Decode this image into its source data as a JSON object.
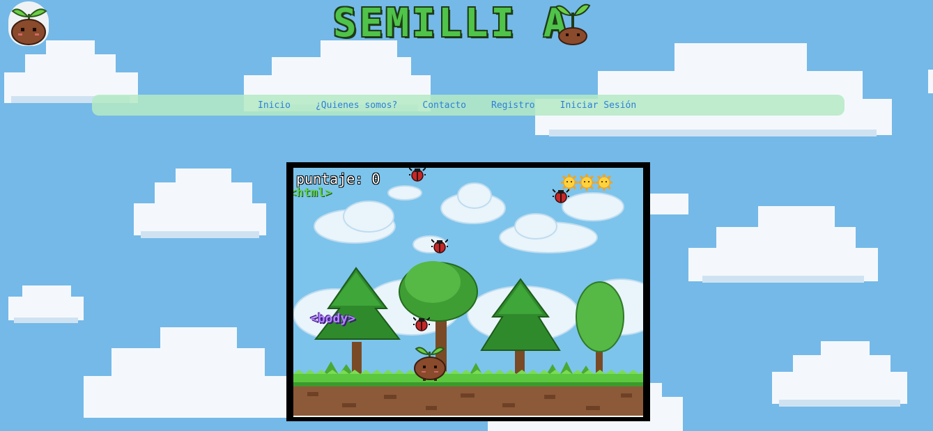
{
  "site": {
    "title": "SEMILLI A",
    "title_letters": [
      "S",
      "E",
      "M",
      "I",
      "L",
      "L",
      "I",
      "A"
    ]
  },
  "nav": {
    "items": [
      {
        "label": "Inicio"
      },
      {
        "label": "¿Quienes somos?"
      },
      {
        "label": "Contacto"
      },
      {
        "label": "Registro"
      },
      {
        "label": "Iniciar Sesión"
      }
    ]
  },
  "game": {
    "score_label": "puntaje:",
    "score_value": "0",
    "lives": 3,
    "life_icon": "sun-icon",
    "enemy_icon": "ladybug-icon",
    "tag_html": "<html>",
    "tag_body": "<body>"
  },
  "colors": {
    "sky": "#74b9e8",
    "title_green": "#4fc34a",
    "nav_bg": "#b4eac4",
    "nav_text": "#2f7fd8",
    "frame": "#000000"
  }
}
